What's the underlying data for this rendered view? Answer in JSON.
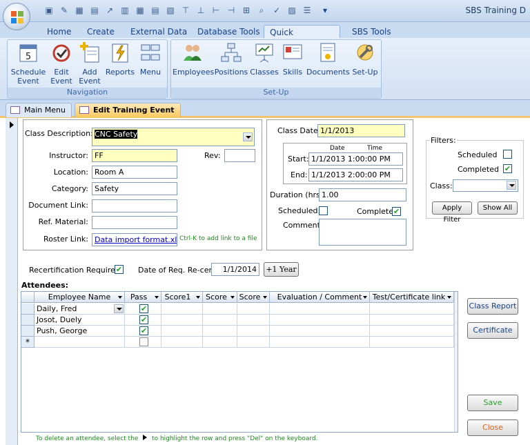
{
  "window": {
    "title": "SBS Training D"
  },
  "ribbon_tabs": [
    "Home",
    "Create",
    "External Data",
    "Database Tools",
    "Quick Navigation",
    "SBS Tools"
  ],
  "ribbon_active_tab": "Quick Navigation",
  "groups": {
    "navigation": {
      "label": "Navigation",
      "buttons": [
        {
          "label1": "Schedule",
          "label2": "Event"
        },
        {
          "label1": "Edit",
          "label2": "Event"
        },
        {
          "label1": "Add",
          "label2": "Event"
        },
        {
          "label1": "Reports",
          "label2": ""
        },
        {
          "label1": "Menu",
          "label2": ""
        }
      ]
    },
    "setup": {
      "label": "Set-Up",
      "buttons": [
        {
          "label1": "Employees"
        },
        {
          "label1": "Positions"
        },
        {
          "label1": "Classes"
        },
        {
          "label1": "Skills"
        },
        {
          "label1": "Documents"
        },
        {
          "label1": "Set-Up"
        }
      ]
    }
  },
  "doc_tabs": {
    "main": "Main Menu",
    "active": "Edit Training Event"
  },
  "form": {
    "class_description_label": "Class Description:",
    "class_description_value": "CNC Safety",
    "instructor_label": "Instructor:",
    "instructor_value": "FF",
    "rev_label": "Rev:",
    "rev_value": "",
    "location_label": "Location:",
    "location_value": "Room A",
    "category_label": "Category:",
    "category_value": "Safety",
    "document_link_label": "Document Link:",
    "document_link_value": "",
    "ref_material_label": "Ref. Material:",
    "ref_material_value": "",
    "roster_link_label": "Roster Link:",
    "roster_link_value": "Data import format.xls",
    "roster_hint": "Ctrl-K to add link to a file",
    "class_date_label": "Class Date:",
    "class_date_value": "1/1/2013",
    "date_header": "Date",
    "time_header": "Time",
    "start_label": "Start:",
    "start_value": "1/1/2013 1:00:00 PM",
    "end_label": "End:",
    "end_value": "1/1/2013 2:00:00 PM",
    "duration_label": "Duration (hrs):",
    "duration_value": "1.00",
    "scheduled_label": "Scheduled:",
    "complete_label": "Complete:",
    "comment_label": "Comment:",
    "comment_value": "",
    "recert_label": "Recertification Required:",
    "recert_date_label": "Date of Req. Re-cert.",
    "recert_date_value": "1/1/2014",
    "plus_year_label": "+1 Year",
    "attendees_label": "Attendees:"
  },
  "filters": {
    "title": "Filters:",
    "scheduled_label": "Scheduled",
    "completed_label": "Completed",
    "class_label": "Class:",
    "class_value": "",
    "apply_label": "Apply Filter",
    "show_all_label": "Show All"
  },
  "grid": {
    "columns": [
      "Employee Name",
      "Pass",
      "Score1",
      "Score",
      "Score",
      "Evaluation / Comment",
      "Test/Certificate link"
    ],
    "rows": [
      {
        "name": "Daily, Fred",
        "pass": true
      },
      {
        "name": "Josot, Duely",
        "pass": true
      },
      {
        "name": "Push, George",
        "pass": true
      }
    ],
    "new_row_marker": "*"
  },
  "buttons": {
    "class_report": "Class Report",
    "certificate": "Certificate",
    "save": "Save",
    "close": "Close"
  },
  "footer_hint_1": "To delete an attendee, select the",
  "footer_hint_2": "to highlight the row and press \"Del\" on the keyboard.",
  "colors": {
    "required_field": "#ffffc0",
    "save_text": "#2f9a2f",
    "close_text": "#e0601a",
    "hint_text": "#1a8c1a"
  }
}
